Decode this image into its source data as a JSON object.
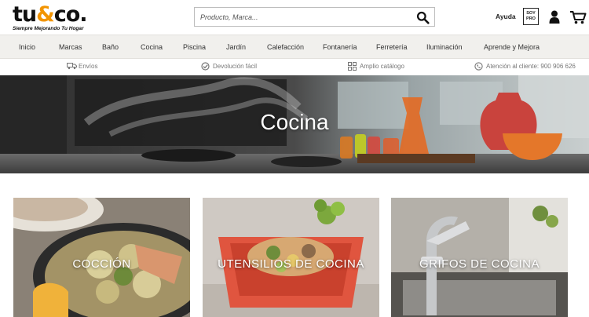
{
  "header": {
    "logo_text_pre": "tu",
    "logo_text_amp": "&",
    "logo_text_post": "co.",
    "logo_tagline": "Siempre Mejorando Tu Hogar",
    "search_placeholder": "Producto, Marca...",
    "help_label": "Ayuda",
    "soypro_line1": "SOY",
    "soypro_line2": "PRO",
    "icons": [
      "search-icon",
      "user-icon",
      "cart-icon"
    ]
  },
  "nav": {
    "items": [
      {
        "label": "Inicio"
      },
      {
        "label": "Marcas"
      },
      {
        "label": "Baño"
      },
      {
        "label": "Cocina"
      },
      {
        "label": "Piscina"
      },
      {
        "label": "Jardín"
      },
      {
        "label": "Calefacción"
      },
      {
        "label": "Fontanería"
      },
      {
        "label": "Ferretería"
      },
      {
        "label": "Iluminación"
      },
      {
        "label": "Aprende y Mejora"
      }
    ]
  },
  "benefits": {
    "items": [
      {
        "label": "Envíos",
        "icon": "truck-icon"
      },
      {
        "label": "Devolución fácil",
        "icon": "check-badge-icon"
      },
      {
        "label": "Amplio catálogo",
        "icon": "grid-icon"
      },
      {
        "label": "Atención al cliente: 900 906 626",
        "icon": "phone-icon"
      }
    ]
  },
  "hero": {
    "title": "Cocina"
  },
  "categories": [
    {
      "label": "COCCIÓN"
    },
    {
      "label": "UTENSILIOS DE COCINA"
    },
    {
      "label": "GRIFOS DE COCINA"
    }
  ],
  "colors": {
    "brand_accent": "#f29400",
    "nav_bg": "#f1f0ed",
    "text_dark": "#222222"
  }
}
